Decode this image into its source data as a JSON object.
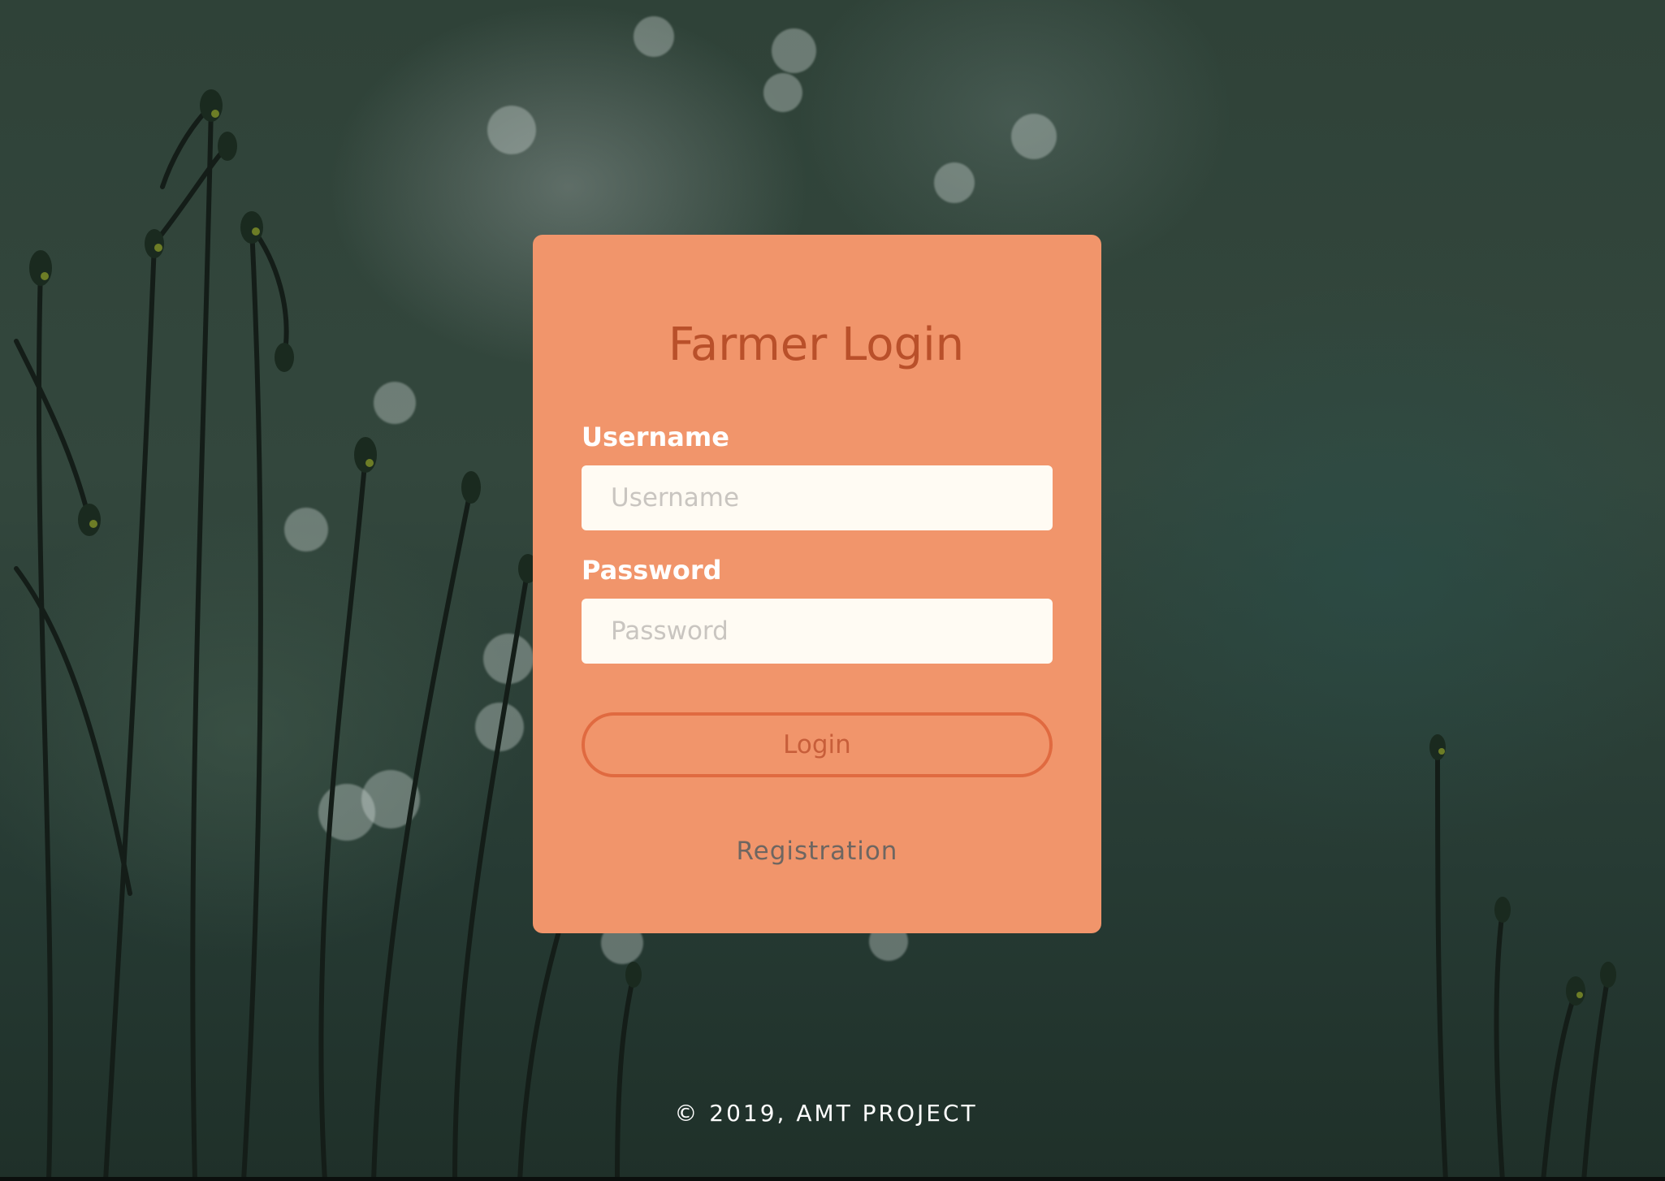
{
  "login_card": {
    "title": "Farmer Login",
    "username_label": "Username",
    "username_placeholder": "Username",
    "username_value": "",
    "password_label": "Password",
    "password_placeholder": "Password",
    "password_value": "",
    "login_button_label": "Login",
    "registration_link_label": "Registration"
  },
  "footer": {
    "copyright": "© 2019, AMT PROJECT"
  },
  "colors": {
    "card_background": "#f1956b",
    "title_color": "#b9502a",
    "input_background": "#fffbf3",
    "button_border": "#e06a40"
  }
}
